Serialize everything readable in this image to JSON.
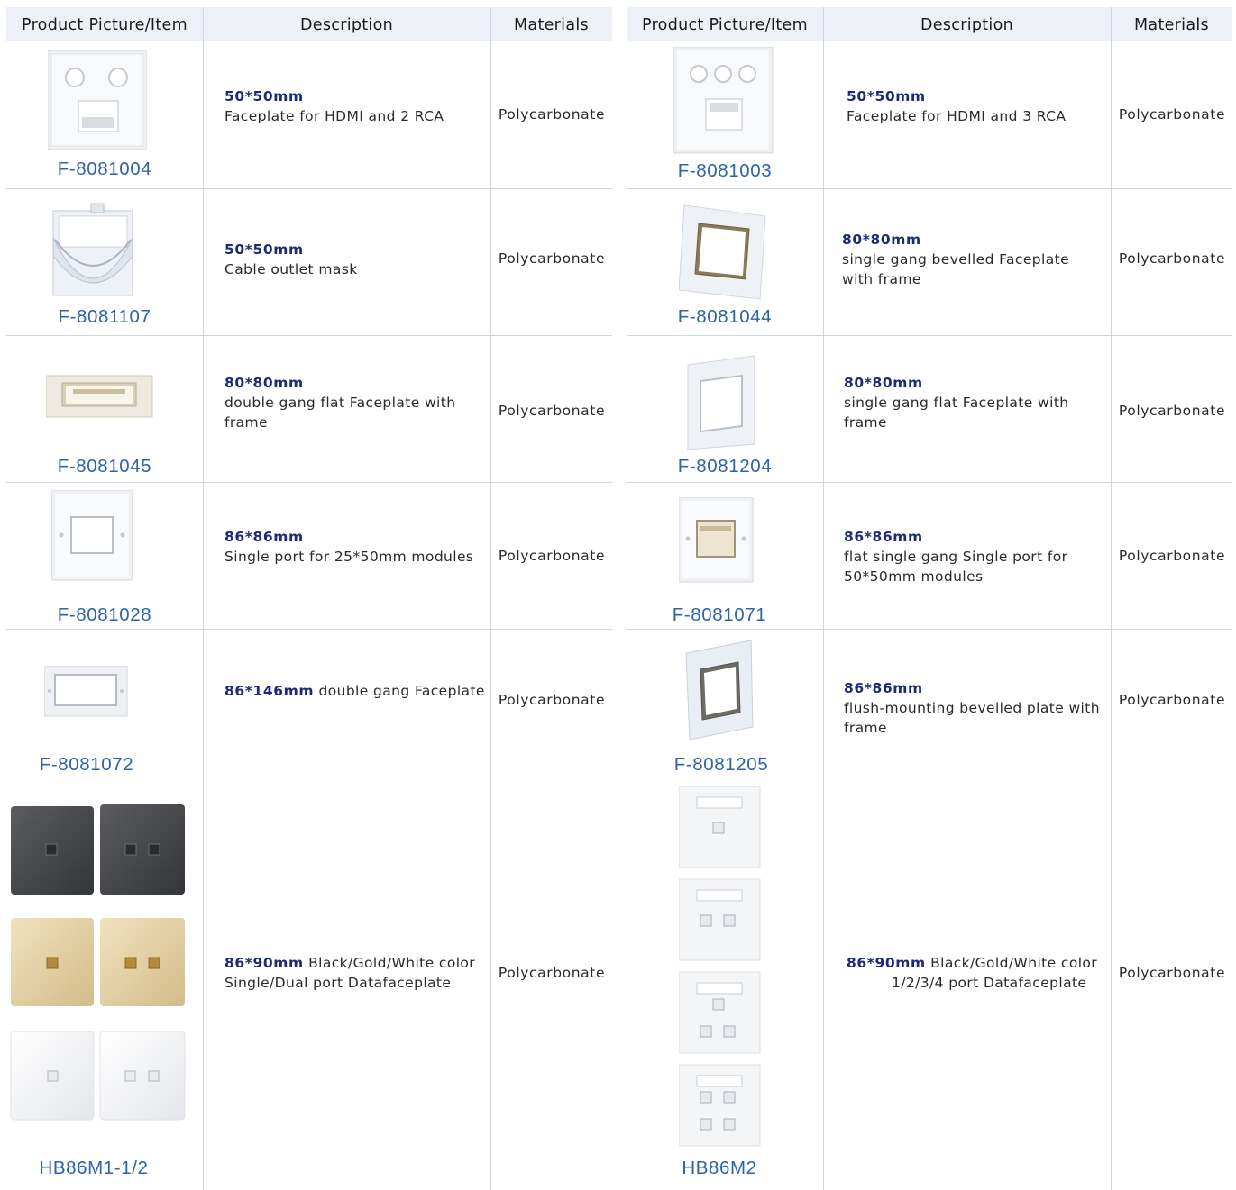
{
  "headers": {
    "item": "Product Picture/Item",
    "description": "Description",
    "materials": "Materials"
  },
  "left_rows": [
    {
      "code": "F-8081004",
      "size": "50*50mm",
      "desc": "Faceplate for HDMI and 2 RCA",
      "material": "Polycarbonate",
      "picture": "faceplate-hdmi-2rca-icon"
    },
    {
      "code": "F-8081107",
      "size": "50*50mm",
      "desc": "Cable outlet mask",
      "material": "Polycarbonate",
      "picture": "cable-outlet-mask-icon"
    },
    {
      "code": "F-8081045",
      "size": "80*80mm",
      "desc": "double gang flat Faceplate with frame",
      "material": "Polycarbonate",
      "picture": "double-gang-flat-faceplate-icon"
    },
    {
      "code": "F-8081028",
      "size": "86*86mm",
      "desc": "Single port for 25*50mm modules",
      "material": "Polycarbonate",
      "picture": "single-port-faceplate-icon"
    },
    {
      "code": "F-8081072",
      "size": "86*146mm",
      "desc": "double gang Faceplate",
      "material": "Polycarbonate",
      "picture": "double-gang-faceplate-icon"
    },
    {
      "code": "HB86M1-1/2",
      "size": "86*90mm",
      "desc_line1": "Black/Gold/White color",
      "desc_line2": "Single/Dual port Datafaceplate",
      "material": "Polycarbonate",
      "picture": "black-gold-white-datafaceplates-icon"
    }
  ],
  "right_rows": [
    {
      "code": "F-8081003",
      "size": "50*50mm",
      "desc": "Faceplate for HDMI and 3 RCA",
      "material": "Polycarbonate",
      "picture": "faceplate-hdmi-3rca-icon"
    },
    {
      "code": "F-8081044",
      "size": "80*80mm",
      "desc": "single gang bevelled Faceplate with frame",
      "material": "Polycarbonate",
      "picture": "single-gang-bevelled-faceplate-icon"
    },
    {
      "code": "F-8081204",
      "size": "80*80mm",
      "desc": "single gang flat Faceplate with frame",
      "material": "Polycarbonate",
      "picture": "single-gang-flat-faceplate-icon"
    },
    {
      "code": "F-8081071",
      "size": "86*86mm",
      "desc": "flat single gang Single port for 50*50mm modules",
      "material": "Polycarbonate",
      "picture": "flat-single-gang-faceplate-icon"
    },
    {
      "code": "F-8081205",
      "size": "86*86mm",
      "desc": "flush-mounting bevelled plate with frame",
      "material": "Polycarbonate",
      "picture": "flush-mounting-bevelled-plate-icon"
    },
    {
      "code": "HB86M2",
      "size": "86*90mm",
      "desc_line1": "Black/Gold/White color",
      "desc_line2": "1/2/3/4 port Datafaceplate",
      "material": "Polycarbonate",
      "picture": "1-2-3-4-port-datafaceplates-icon"
    }
  ],
  "colors": {
    "code_text": "#2d63a8",
    "size_text": "#1c2a7a",
    "header_bg": "#edf1f7"
  }
}
